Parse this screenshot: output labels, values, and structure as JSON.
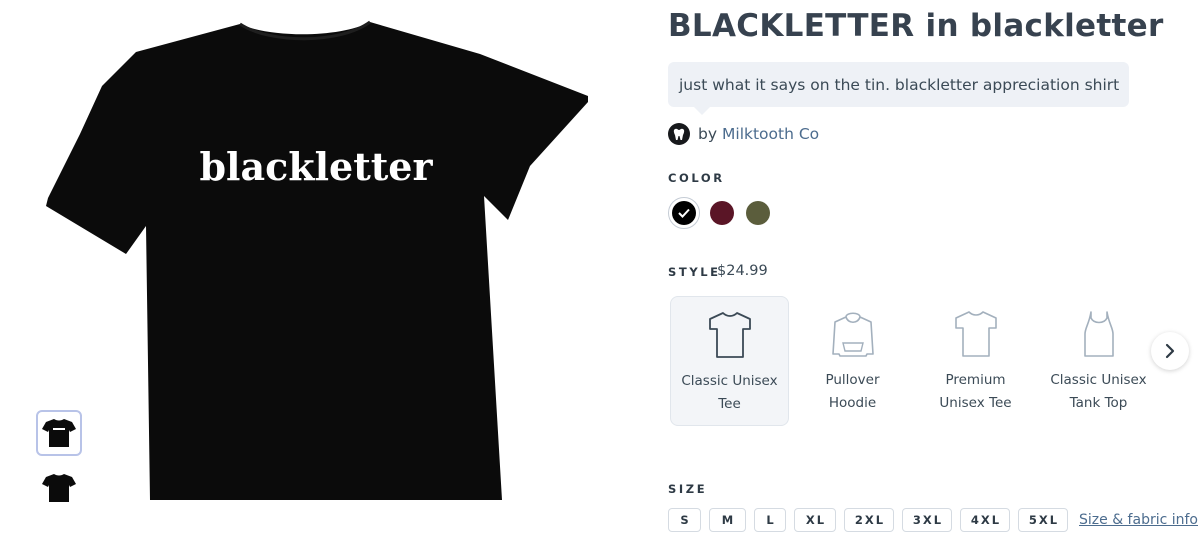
{
  "product": {
    "title": "BLACKLETTER in blackletter",
    "description": "just what it says on the tin. blackletter appreciation shirt",
    "by_label": "by",
    "author": "Milktooth Co",
    "print_text": "blackletter"
  },
  "color_section": {
    "label": "COLOR",
    "swatches": [
      {
        "name": "black",
        "hex": "#000000",
        "selected": true
      },
      {
        "name": "maroon",
        "hex": "#5a1526",
        "selected": false
      },
      {
        "name": "olive",
        "hex": "#5b5d3c",
        "selected": false
      }
    ]
  },
  "style_section": {
    "label": "STYLE",
    "price": "$24.99",
    "options": [
      {
        "name": "Classic Unisex Tee",
        "icon": "tee-icon",
        "selected": true
      },
      {
        "name": "Pullover Hoodie",
        "icon": "hoodie-icon",
        "selected": false
      },
      {
        "name": "Premium Unisex Tee",
        "icon": "tee-icon",
        "selected": false
      },
      {
        "name": "Classic Unisex Tank Top",
        "icon": "tank-top-icon",
        "selected": false
      }
    ],
    "next_icon": "chevron-right-icon"
  },
  "size_section": {
    "label": "SIZE",
    "sizes": [
      "S",
      "M",
      "L",
      "XL",
      "2XL",
      "3XL",
      "4XL",
      "5XL"
    ],
    "info_link": "Size & fabric info"
  },
  "thumbnails": [
    {
      "name": "shirt-front-thumbnail",
      "selected": true
    },
    {
      "name": "shirt-back-thumbnail",
      "selected": false
    }
  ],
  "colors": {
    "shirt": "#0b0b0b",
    "link": "#4c6c8e",
    "bubble": "#eef1f6"
  }
}
